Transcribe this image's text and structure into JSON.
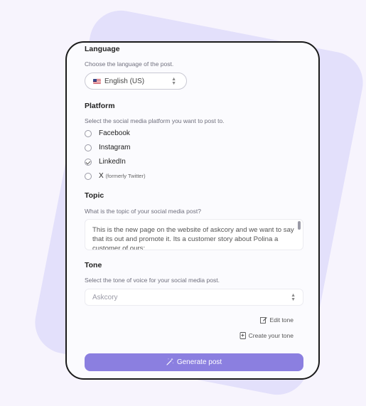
{
  "language": {
    "heading": "Language",
    "subtitle": "Choose the language of the post.",
    "selected": "English (US)"
  },
  "platform": {
    "heading": "Platform",
    "subtitle": "Select the social media platform you want to post to.",
    "options": [
      {
        "label": "Facebook",
        "checked": false
      },
      {
        "label": "Instagram",
        "checked": false
      },
      {
        "label": "LinkedIn",
        "checked": true
      },
      {
        "label": "X",
        "note": "(formerly Twitter)",
        "checked": false
      }
    ]
  },
  "topic": {
    "heading": "Topic",
    "subtitle": "What is the topic of your social media post?",
    "value": "This is the new page on the website of askcory and we want to say that its out and promote it. Its a customer story about Polina a customer of ours:"
  },
  "tone": {
    "heading": "Tone",
    "subtitle": "Select the tone of voice for your social media post.",
    "placeholder": "Askcory",
    "edit_label": "Edit tone",
    "create_label": "Create your tone"
  },
  "generate_label": "Generate post",
  "colors": {
    "accent": "#8b7fe0",
    "background": "#f7f4fd",
    "card": "#e3e0fb"
  }
}
